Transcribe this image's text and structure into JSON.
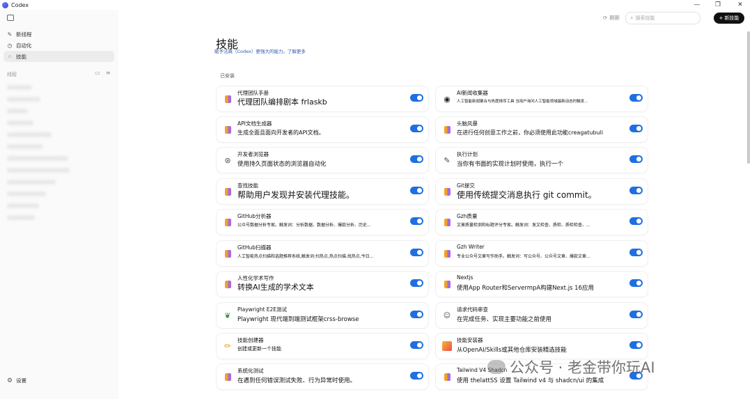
{
  "app": {
    "title": "Codex"
  },
  "window": {
    "minimize": "—",
    "restore": "❐",
    "close": "✕"
  },
  "sidebar": {
    "nav": [
      {
        "icon": "✎",
        "label": "新线程"
      },
      {
        "icon": "◷",
        "label": "自动化"
      },
      {
        "icon": "⁘",
        "label": "技能"
      }
    ],
    "section_label": "线程",
    "settings_label": "设置"
  },
  "header": {
    "refresh_label": "刷新",
    "search_placeholder": "搜索技能",
    "new_skill_label": "新技能"
  },
  "main": {
    "title": "技能",
    "subtitle": "赋予法典（Codex）更强大的能力。了解更多",
    "installed_label": "已安装"
  },
  "skills": [
    {
      "name": "代理团队手册",
      "desc": "代理团队编排剧本 frlaskb",
      "icon": "cube",
      "enabled": true,
      "desc_size": 11
    },
    {
      "name": "AI新闻收集器",
      "desc": "人工智能新闻聚合与热度排序工具 当用户询问人工智能领域最新动态时触发...",
      "icon": "github",
      "enabled": true,
      "desc_size": 5.5
    },
    {
      "name": "API文档生成器",
      "desc": "生成全面且面向开发者的API文档。",
      "icon": "cube",
      "enabled": true,
      "desc_size": 8
    },
    {
      "name": "头脑风暴",
      "desc": "在进行任何创意工作之前，你必须使用此功能creagatubuli",
      "icon": "cube",
      "enabled": true,
      "desc_size": 8
    },
    {
      "name": "开发者浏览器",
      "desc": "使用持久页面状态的浏览器自动化",
      "icon": "chrome",
      "enabled": true,
      "desc_size": 8.5
    },
    {
      "name": "执行计划",
      "desc": "当你有书面的实现计划时使用，执行一个",
      "icon": "pencil",
      "enabled": true,
      "desc_size": 8.5
    },
    {
      "name": "查找技能",
      "desc": "帮助用户发现并安装代理技能。",
      "icon": "cube",
      "enabled": true,
      "desc_size": 12
    },
    {
      "name": "Git提交",
      "desc": "使用传统提交消息执行 git commit。",
      "icon": "cube",
      "enabled": true,
      "desc_size": 12
    },
    {
      "name": "GitHub分析器",
      "desc": "公众号数据分析专家。触发词：分析数据、数据分析、爆款分析、历史...",
      "icon": "cube",
      "enabled": true,
      "desc_size": 6
    },
    {
      "name": "Gzh质量",
      "desc": "文章质量检测和标题评分专家。触发词：发文检查、质检、质检检查、...",
      "icon": "cube",
      "enabled": true,
      "desc_size": 6
    },
    {
      "name": "GitHub扫描器",
      "desc": "人工智能热点扫描和选题推荐系统,触发词:扫热点,热点扫描,找热点,今日...",
      "icon": "cube",
      "enabled": true,
      "desc_size": 6
    },
    {
      "name": "Gzh Writer",
      "desc": "专业公众号文章写作助手。触发词：写公众号、公众号文章、爆款文章...",
      "icon": "cube",
      "enabled": true,
      "desc_size": 6
    },
    {
      "name": "人性化学术写作",
      "desc": "转换AI生成的学术文本",
      "icon": "cube",
      "enabled": true,
      "desc_size": 11
    },
    {
      "name": "Nextjs",
      "desc": "使用App Router和ServermpA构建Next.js 16应用",
      "icon": "cube",
      "enabled": true,
      "desc_size": 8.5
    },
    {
      "name": "Playwright E2E测试",
      "desc": "Playwright 现代端到端测试框架crss-browse",
      "icon": "leaf",
      "enabled": true,
      "desc_size": 8.5
    },
    {
      "name": "请求代码审查",
      "desc": "在完成任务、实现主要功能之前使用",
      "icon": "review",
      "enabled": true,
      "desc_size": 8.5
    },
    {
      "name": "技能创建器",
      "desc": "创建或更新一个技能",
      "icon": "brush",
      "enabled": true,
      "desc_size": 7
    },
    {
      "name": "技能安装器",
      "desc": "从OpenAI/Skills或其他仓库安装精选技能",
      "icon": "installer",
      "enabled": true,
      "desc_size": 8.5
    },
    {
      "name": "系统化测试",
      "desc": "在遇到任何错误测试失败、行为异常时使用。",
      "icon": "cube",
      "enabled": true,
      "desc_size": 8.5
    },
    {
      "name": "Tailwind V4 Shadcn",
      "desc": "使用 thelattSS 设置 Tailwind v4 与 shadcn/ui 的集成",
      "icon": "cube",
      "enabled": true,
      "desc_size": 8.5
    }
  ],
  "watermark": {
    "text": "公众号 · 老金带你玩AI"
  }
}
